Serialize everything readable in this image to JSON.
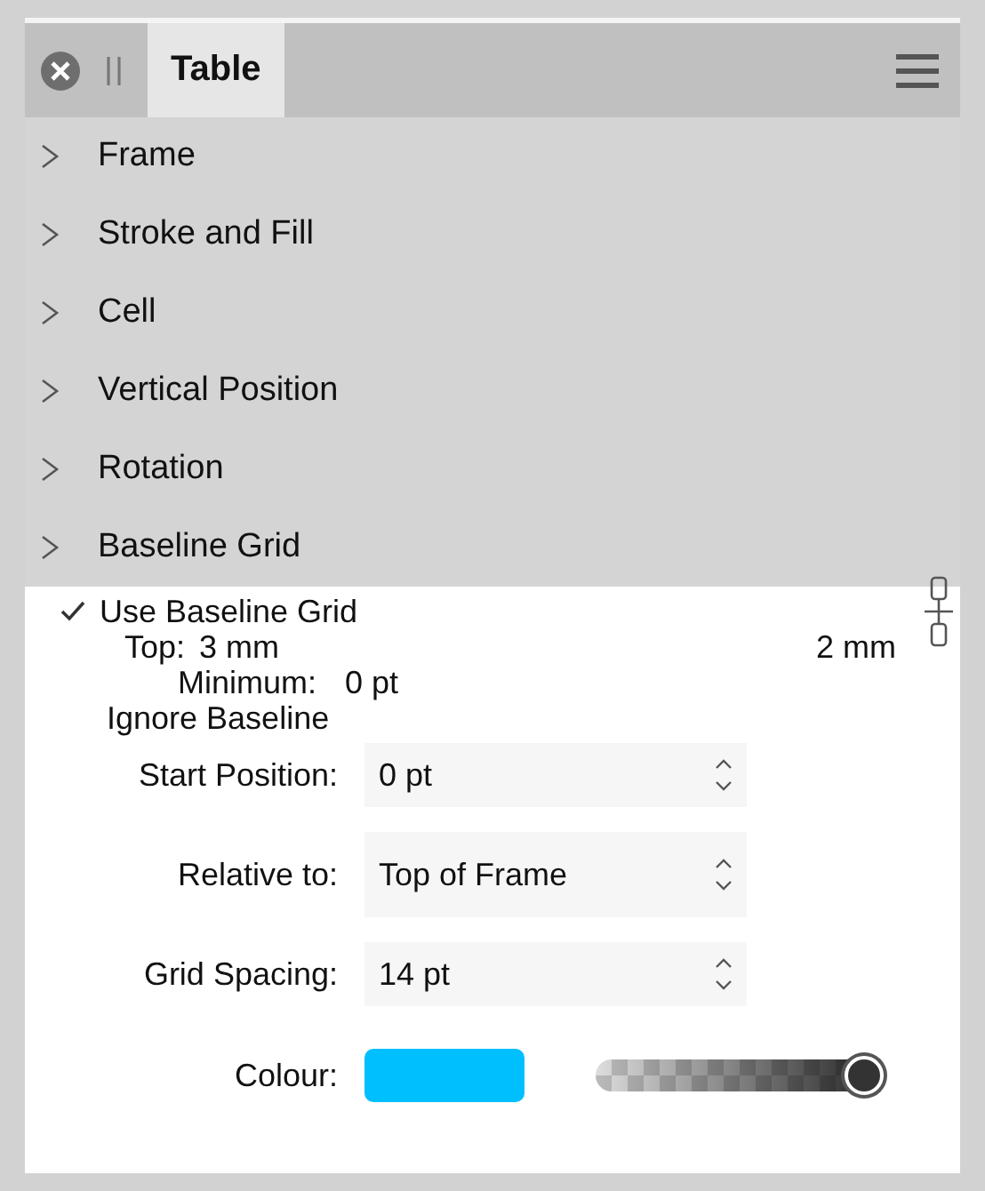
{
  "header": {
    "tabs": [
      {
        "label": "Table",
        "selected": true
      }
    ]
  },
  "sections": [
    {
      "label": "Frame",
      "expanded": false
    },
    {
      "label": "Stroke and Fill",
      "expanded": false
    },
    {
      "label": "Cell",
      "expanded": false
    },
    {
      "label": "Vertical Position",
      "expanded": false
    },
    {
      "label": "Rotation",
      "expanded": false
    },
    {
      "label": "Baseline Grid",
      "expanded": false
    }
  ],
  "baseline_grid": {
    "use_baseline_grid": {
      "label": "Use Baseline Grid",
      "checked": true
    },
    "top": {
      "label": "Top:",
      "value": "3 mm"
    },
    "column_2_value": "2 mm",
    "minimum": {
      "label": "Minimum:",
      "value": "0 pt"
    },
    "ignore_baseline": {
      "label": "Ignore Baseline"
    },
    "fields": [
      {
        "kind": "spin",
        "label": "Start Position:",
        "value": "0 pt"
      },
      {
        "kind": "select",
        "label": "Relative to:",
        "value": "Top of Frame"
      },
      {
        "kind": "spin",
        "label": "Grid Spacing:",
        "value": "14 pt"
      },
      {
        "kind": "colour",
        "label": "Colour:",
        "color": "#00bfff",
        "level": 1
      }
    ]
  }
}
